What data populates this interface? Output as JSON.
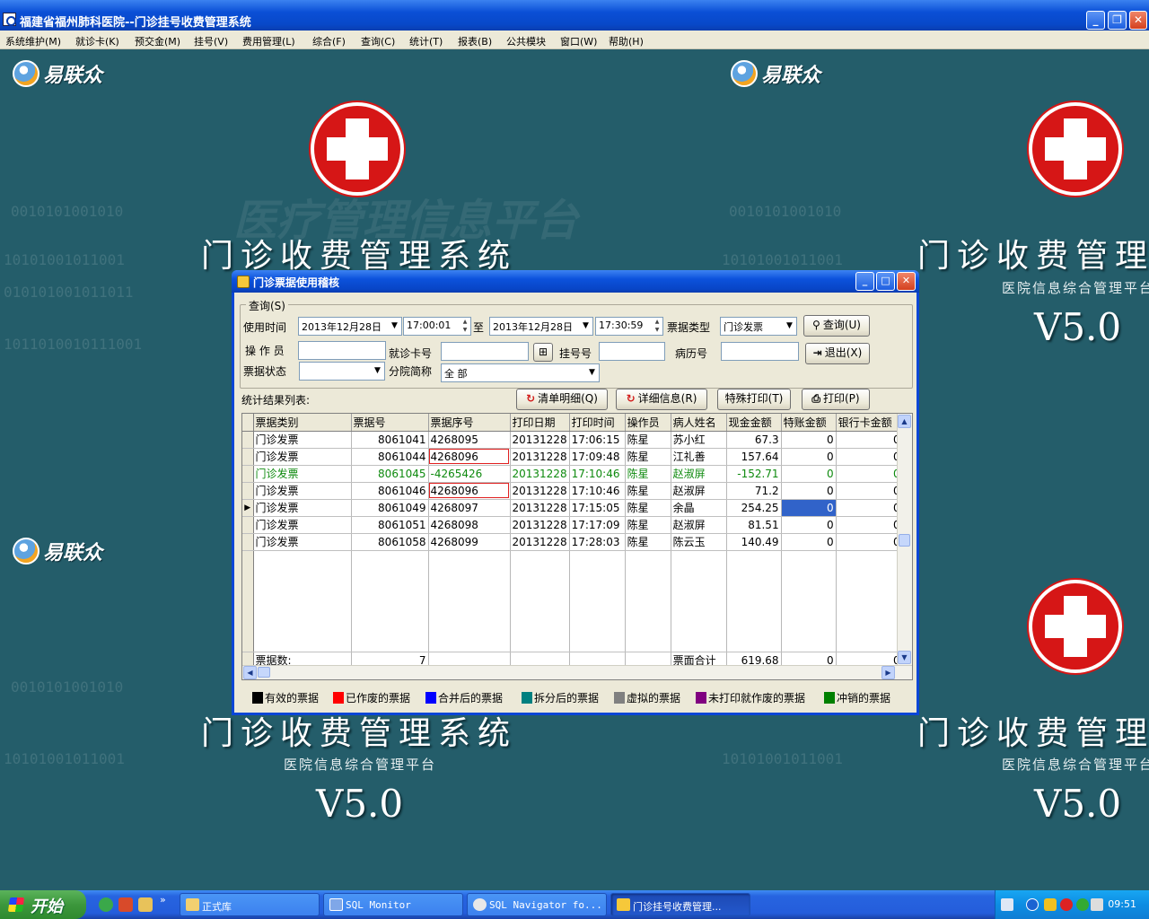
{
  "window": {
    "title": "福建省福州肺科医院--门诊挂号收费管理系统"
  },
  "menu": [
    "系统维护(M)",
    "就诊卡(K)",
    "预交金(M)",
    "挂号(V)",
    "费用管理(L)",
    "综合(F)",
    "查询(C)",
    "统计(T)",
    "报表(B)",
    "公共模块",
    "窗口(W)",
    "帮助(H)"
  ],
  "background": {
    "logo_text": "易联众",
    "system_name": "门诊收费管理系统",
    "platform": "医院信息综合管理平台",
    "version": "V5.0",
    "watermark": "医疗管理信息平台",
    "binary_a": "0010101001010",
    "binary_b": "10101001011001",
    "binary_c": "010101001011011",
    "binary_d": "1011010010111001"
  },
  "dialog": {
    "title": "门诊票据使用稽核",
    "query_group": "查询(S)",
    "labels": {
      "time": "使用时间",
      "to": "至",
      "invoice_type": "票据类型",
      "operator": "操 作 员",
      "card_no": "就诊卡号",
      "reg_no": "挂号号",
      "record_no": "病历号",
      "status": "票据状态",
      "branch": "分院简称",
      "result_list": "统计结果列表:"
    },
    "fields": {
      "date_from": "2013年12月28日",
      "time_from": "17:00:01",
      "date_to": "2013年12月28日",
      "time_to": "17:30:59",
      "invoice_type": "门诊发票",
      "operator": "",
      "card_no": "",
      "reg_no": "",
      "record_no": "",
      "status": "",
      "branch": "全 部"
    },
    "buttons": {
      "query": "查询(U)",
      "exit": "退出(X)",
      "clear_detail": "清单明细(Q)",
      "detail_info": "详细信息(R)",
      "special_print": "特殊打印(T)",
      "print": "打印(P)"
    }
  },
  "grid": {
    "columns": [
      "票据类别",
      "票据号",
      "票据序号",
      "打印日期",
      "打印时间",
      "操作员",
      "病人姓名",
      "现金金额",
      "特账金额",
      "银行卡金额"
    ],
    "rows": [
      [
        "门诊发票",
        "8061041",
        "4268095",
        "20131228",
        "17:06:15",
        "陈星",
        "苏小红",
        "67.3",
        "0",
        "0"
      ],
      [
        "门诊发票",
        "8061044",
        "4268096",
        "20131228",
        "17:09:48",
        "陈星",
        "江礼善",
        "157.64",
        "0",
        "0"
      ],
      [
        "门诊发票",
        "8061045",
        "-4265426",
        "20131228",
        "17:10:46",
        "陈星",
        "赵淑屏",
        "-152.71",
        "0",
        "0"
      ],
      [
        "门诊发票",
        "8061046",
        "4268096",
        "20131228",
        "17:10:46",
        "陈星",
        "赵淑屏",
        "71.2",
        "0",
        "0"
      ],
      [
        "门诊发票",
        "8061049",
        "4268097",
        "20131228",
        "17:15:05",
        "陈星",
        "余晶",
        "254.25",
        "0",
        "0"
      ],
      [
        "门诊发票",
        "8061051",
        "4268098",
        "20131228",
        "17:17:09",
        "陈星",
        "赵淑屏",
        "81.51",
        "0",
        "0"
      ],
      [
        "门诊发票",
        "8061058",
        "4268099",
        "20131228",
        "17:28:03",
        "陈星",
        "陈云玉",
        "140.49",
        "0",
        "0"
      ]
    ],
    "footer": {
      "count_label": "票据数:",
      "count": "7",
      "total_label": "票面合计",
      "total_cash": "619.68",
      "total_special": "0",
      "total_bank": "0"
    }
  },
  "legend": [
    {
      "label": "有效的票据",
      "color": "#000000"
    },
    {
      "label": "已作废的票据",
      "color": "#ff0000"
    },
    {
      "label": "合并后的票据",
      "color": "#0000ff"
    },
    {
      "label": "拆分后的票据",
      "color": "#008080"
    },
    {
      "label": "虚拟的票据",
      "color": "#808080"
    },
    {
      "label": "未打印就作废的票据",
      "color": "#800080"
    },
    {
      "label": "冲销的票据",
      "color": "#008000"
    }
  ],
  "taskbar": {
    "start": "开始",
    "tasks": [
      "正式库",
      "SQL Monitor",
      "SQL Navigator fo...",
      "门诊挂号收费管理..."
    ],
    "clock": "09:51"
  }
}
